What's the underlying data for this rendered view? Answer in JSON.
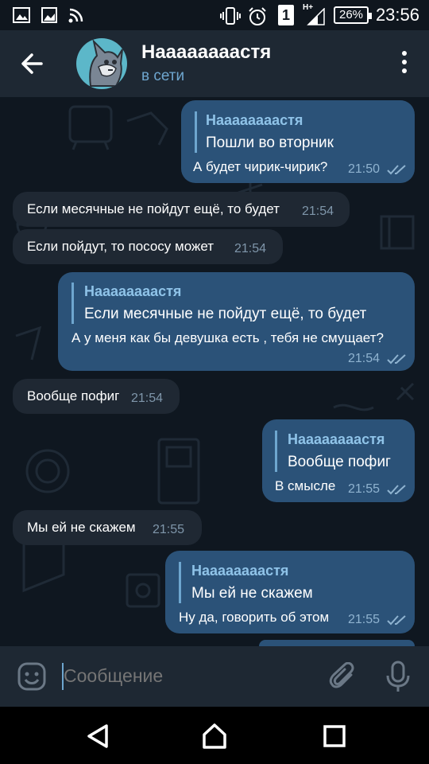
{
  "status_bar": {
    "time": "23:56",
    "battery": "26%",
    "sim": "1",
    "network": "H+"
  },
  "header": {
    "contact_name": "Наааааааастя",
    "contact_status": "в сети"
  },
  "messages": [
    {
      "direction": "out",
      "reply_to_name": "Наааааааастя",
      "reply_to_text": "Пошли во вторник",
      "text": "А будет чирик-чирик?",
      "time": "21:50",
      "status": "read"
    },
    {
      "direction": "in",
      "text": "Если месячные не пойдут ещё, то будет",
      "time": "21:54"
    },
    {
      "direction": "in",
      "text": "Если пойдут, то пососу может",
      "time": "21:54"
    },
    {
      "direction": "out",
      "reply_to_name": "Наааааааастя",
      "reply_to_text": "Если месячные не пойдут ещё, то будет",
      "text": "А у меня как бы девушка есть , тебя не смущает?",
      "time": "21:54",
      "status": "read"
    },
    {
      "direction": "in",
      "text": "Вообще пофиг",
      "time": "21:54"
    },
    {
      "direction": "out",
      "reply_to_name": "Наааааааастя",
      "reply_to_text": "Вообще пофиг",
      "text": "В смысле",
      "time": "21:55",
      "status": "read"
    },
    {
      "direction": "in",
      "text": "Мы ей не скажем",
      "time": "21:55"
    },
    {
      "direction": "out",
      "reply_to_name": "Наааааааастя",
      "reply_to_text": "Мы ей не скажем",
      "text": "Ну да, говорить об этом",
      "time": "21:55",
      "status": "read"
    }
  ],
  "input": {
    "placeholder": "Сообщение",
    "value": ""
  },
  "icons": {
    "back": "arrow-left-icon",
    "menu": "more-vertical-icon",
    "emoji": "emoji-icon",
    "attach": "paperclip-icon",
    "mic": "microphone-icon",
    "nav_back": "triangle-back-icon",
    "nav_home": "home-icon",
    "nav_recents": "square-recents-icon"
  },
  "colors": {
    "header_bg": "#1e2833",
    "chat_bg": "#0f1720",
    "incoming_bubble": "#1f2833",
    "outgoing_bubble": "#2b5278",
    "accent": "#6ea6cf"
  }
}
